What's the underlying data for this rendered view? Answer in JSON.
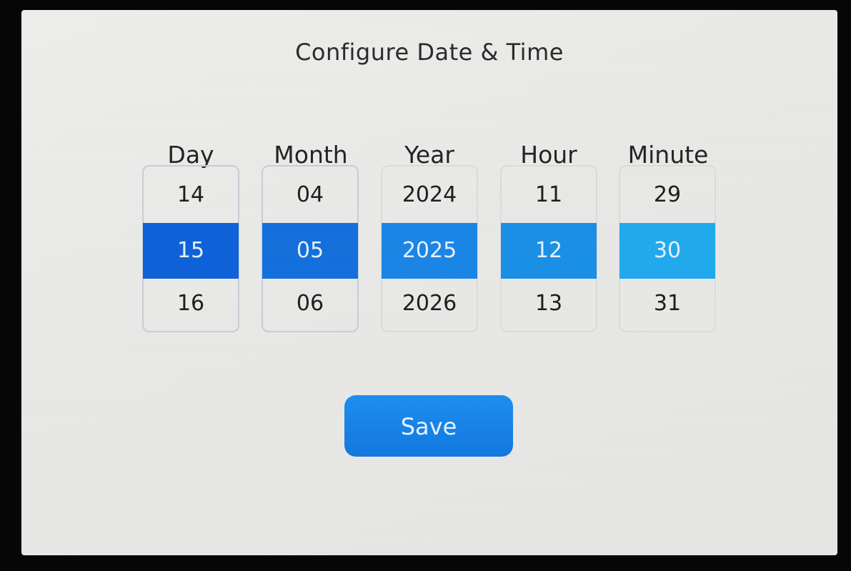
{
  "title": "Configure Date & Time",
  "colors": {
    "day_selected": "#0f62d9",
    "month_selected": "#1470dc",
    "year_selected": "#1b86e6",
    "hour_selected": "#1a90e6",
    "minute_selected": "#22aaee",
    "save_button": "#1683e8"
  },
  "columns": [
    {
      "label": "Day",
      "prev": "14",
      "selected": "15",
      "next": "16"
    },
    {
      "label": "Month",
      "prev": "04",
      "selected": "05",
      "next": "06"
    },
    {
      "label": "Year",
      "prev": "2024",
      "selected": "2025",
      "next": "2026"
    },
    {
      "label": "Hour",
      "prev": "11",
      "selected": "12",
      "next": "13"
    },
    {
      "label": "Minute",
      "prev": "29",
      "selected": "30",
      "next": "31"
    }
  ],
  "save_label": "Save"
}
